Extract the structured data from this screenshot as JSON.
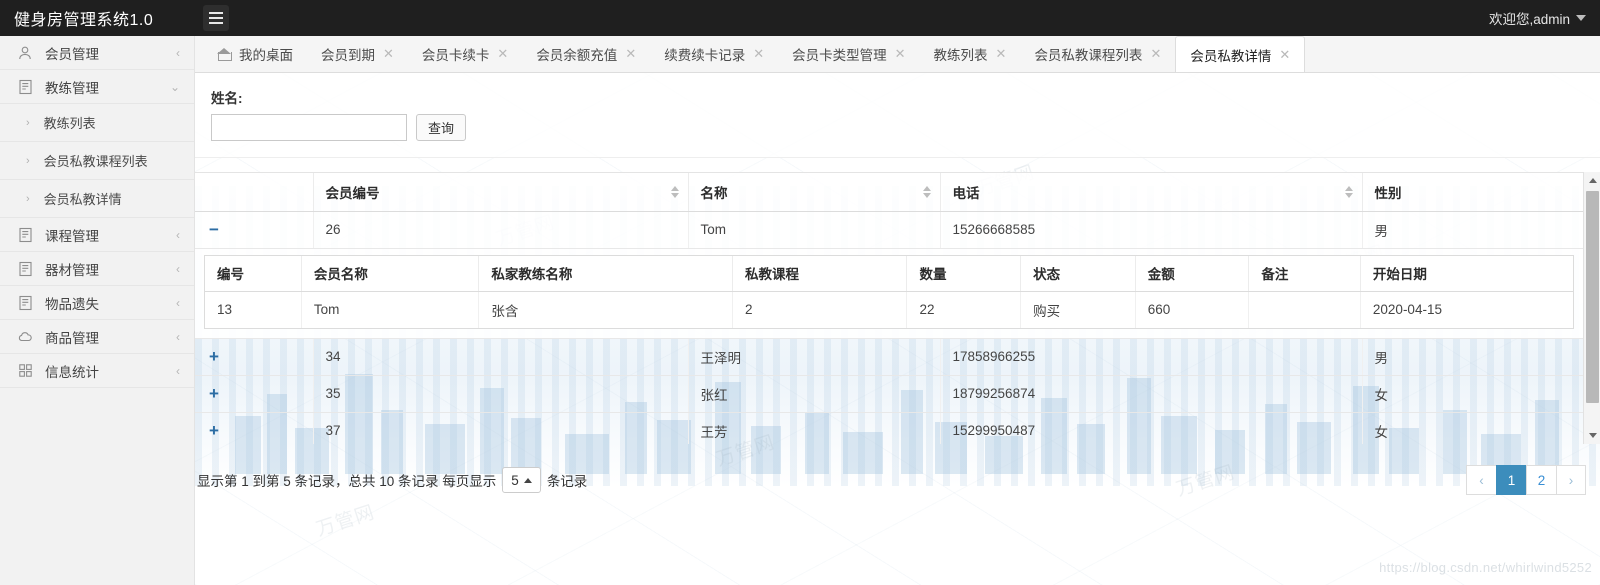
{
  "app": {
    "title": "健身房管理系统1.0",
    "menu_toggle_icon": "hamburger-icon",
    "welcome": "欢迎您,admin"
  },
  "sidebar": {
    "items": [
      {
        "label": "会员管理",
        "icon": "user-icon",
        "arrow": "‹"
      },
      {
        "label": "教练管理",
        "icon": "document-icon",
        "arrow": "⌄"
      },
      {
        "label": "课程管理",
        "icon": "document-icon",
        "arrow": "‹"
      },
      {
        "label": "器材管理",
        "icon": "document-icon",
        "arrow": "‹"
      },
      {
        "label": "物品遗失",
        "icon": "document-icon",
        "arrow": "‹"
      },
      {
        "label": "商品管理",
        "icon": "cloud-icon",
        "arrow": "‹"
      },
      {
        "label": "信息统计",
        "icon": "grid-icon",
        "arrow": "‹"
      }
    ],
    "subitems": [
      {
        "label": "教练列表",
        "arrow": "›"
      },
      {
        "label": "会员私教课程列表",
        "arrow": "›"
      },
      {
        "label": "会员私教详情",
        "arrow": "›"
      }
    ]
  },
  "tabs": [
    {
      "label": "我的桌面",
      "closable": false,
      "active": false,
      "icon": "home-icon"
    },
    {
      "label": "会员到期",
      "closable": true,
      "active": false
    },
    {
      "label": "会员卡续卡",
      "closable": true,
      "active": false
    },
    {
      "label": "会员余额充值",
      "closable": true,
      "active": false
    },
    {
      "label": "续费续卡记录",
      "closable": true,
      "active": false
    },
    {
      "label": "会员卡类型管理",
      "closable": true,
      "active": false
    },
    {
      "label": "教练列表",
      "closable": true,
      "active": false
    },
    {
      "label": "会员私教课程列表",
      "closable": true,
      "active": false
    },
    {
      "label": "会员私教详情",
      "closable": true,
      "active": true
    }
  ],
  "search": {
    "label": "姓名:",
    "value": "",
    "placeholder": "",
    "button": "查询"
  },
  "table": {
    "headers": [
      "",
      "会员编号",
      "名称",
      "电话",
      "性别"
    ],
    "sortable": [
      false,
      true,
      true,
      true,
      false
    ],
    "rows": [
      {
        "toggle": "−",
        "expanded": true,
        "member_id": "26",
        "name": "Tom",
        "phone": "15266668585",
        "gender": "男"
      },
      {
        "toggle": "+",
        "expanded": false,
        "member_id": "34",
        "name": "王泽明",
        "phone": "17858966255",
        "gender": "男"
      },
      {
        "toggle": "+",
        "expanded": false,
        "member_id": "35",
        "name": "张红",
        "phone": "18799256874",
        "gender": "女"
      },
      {
        "toggle": "+",
        "expanded": false,
        "member_id": "37",
        "name": "王芳",
        "phone": "15299950487",
        "gender": "女"
      },
      {
        "toggle": "+",
        "expanded": false,
        "member_id": "",
        "name": "",
        "phone": "",
        "gender": ""
      }
    ]
  },
  "detail_table": {
    "headers": [
      "编号",
      "会员名称",
      "私家教练名称",
      "私教课程",
      "数量",
      "状态",
      "金额",
      "备注",
      "开始日期"
    ],
    "rows": [
      {
        "id": "13",
        "member_name": "Tom",
        "coach_name": "张含",
        "course": "2",
        "quantity": "22",
        "status": "购买",
        "amount": "660",
        "remark": "",
        "start_date": "2020-04-15"
      }
    ]
  },
  "footer": {
    "info_prefix": "显示第 1 到第 5 条记录，总共 10 条记录 每页显示",
    "page_size": "5",
    "info_suffix": "条记录",
    "pager": {
      "prev": "‹",
      "pages": [
        "1",
        "2"
      ],
      "active_page": "1",
      "next": "›"
    }
  },
  "watermark": {
    "url_text": "https://blog.csdn.net/whirlwind5252",
    "tiles": [
      "万管网",
      "万管网",
      "万管网",
      "万管网",
      "万管网",
      "万管网"
    ]
  },
  "colors": {
    "topbar_bg": "#1f1f1f",
    "sidebar_bg": "#f2f2f2",
    "accent": "#3c8dbc",
    "toggle_icon": "#2b6ca3",
    "link": "#3a8fd4"
  }
}
